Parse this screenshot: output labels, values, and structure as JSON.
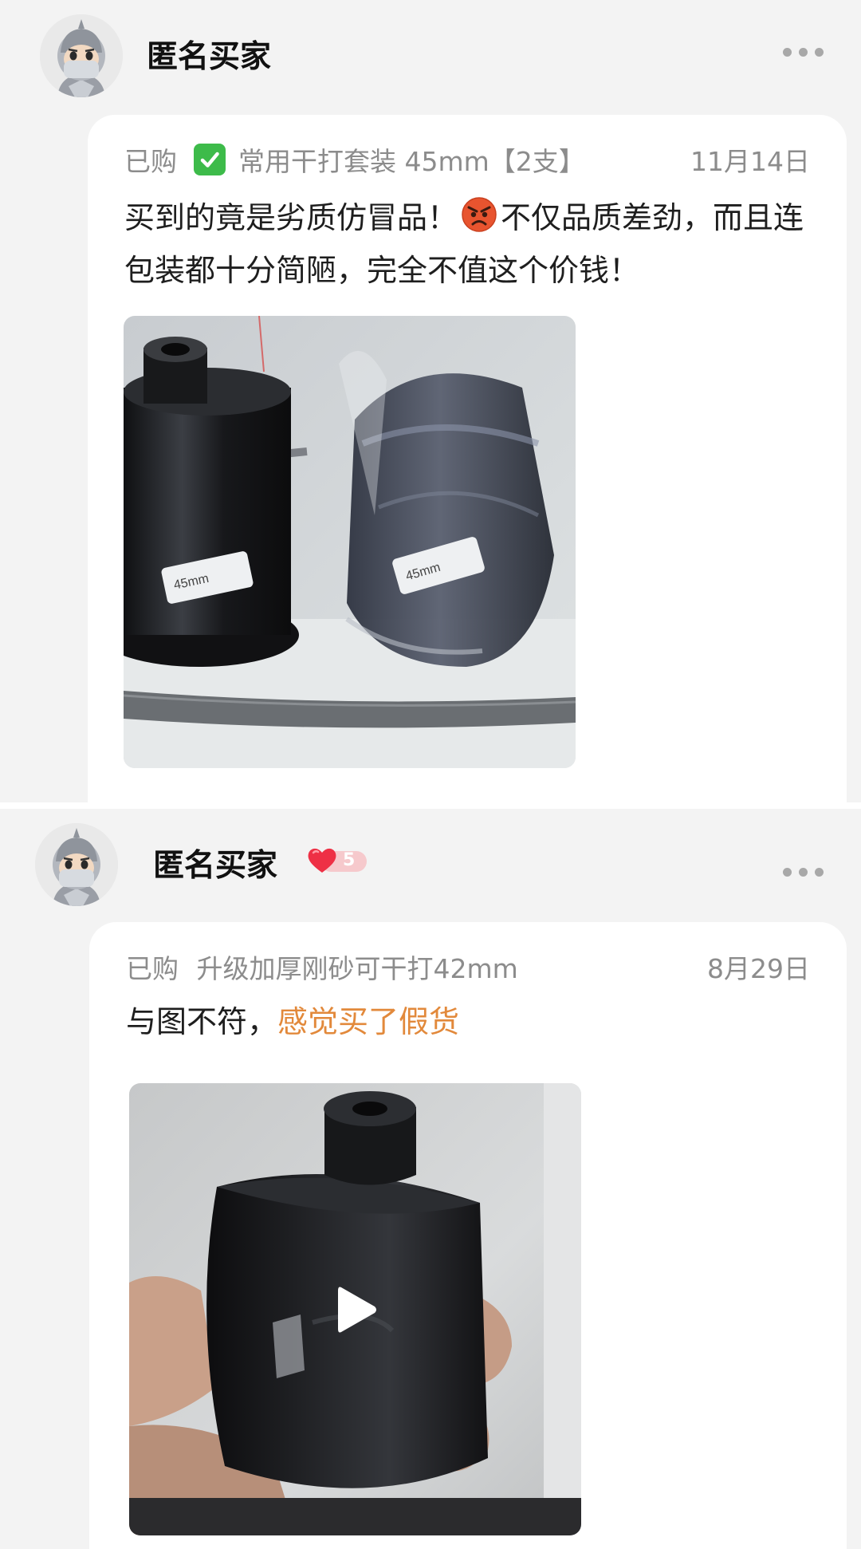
{
  "reviews": [
    {
      "username": "匿名买家",
      "purchase_prefix": "已购",
      "product_name": "常用干打套装 45mm【2支】",
      "date": "11月14日",
      "text_before_emoji": "买到的竟是劣质仿冒品！",
      "text_after_emoji": "不仅品质差劲，而且连包装都十分简陋，完全不值这个价钱！",
      "check_icon": "check-mark-icon",
      "emoji_icon": "angry-face-icon",
      "photo_label": "45mm"
    },
    {
      "username": "匿名买家",
      "vip_level": "5",
      "purchase_prefix": "已购",
      "product_name": "升级加厚刚砂可干打42mm",
      "date": "8月29日",
      "text_plain": "与图不符，",
      "text_highlight": "感觉买了假货",
      "highlight_color": "#e2893b",
      "media_icon": "play-icon"
    }
  ],
  "colors": {
    "page_background": "#f3f3f3",
    "card_background": "#ffffff",
    "muted_text": "#8c8c8c"
  }
}
